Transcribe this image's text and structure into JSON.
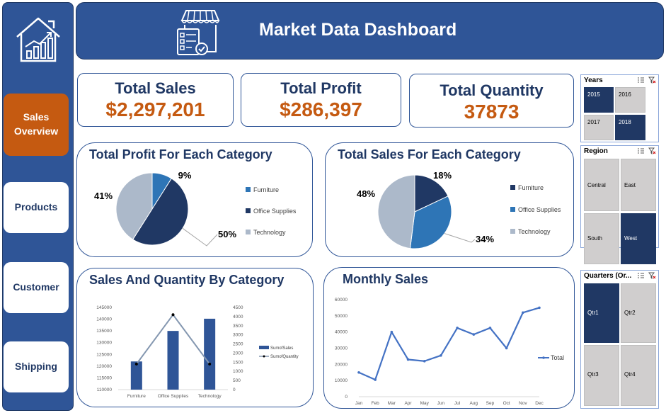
{
  "sidebar": {
    "logo_icon": "house-growth-chart-icon",
    "items": [
      {
        "label_lines": [
          "Sales",
          "Overview"
        ],
        "active": true
      },
      {
        "label_lines": [
          "Products"
        ],
        "active": false
      },
      {
        "label_lines": [
          "Customer"
        ],
        "active": false
      },
      {
        "label_lines": [
          "Shipping"
        ],
        "active": false
      }
    ]
  },
  "header": {
    "logo_icon": "storefront-checklist-icon",
    "title": "Market Data Dashboard"
  },
  "kpis": [
    {
      "label": "Total Sales",
      "value": "$2,297,201"
    },
    {
      "label": "Total Profit",
      "value": "$286,397"
    },
    {
      "label": "Total Quantity",
      "value": "37873"
    }
  ],
  "colors": {
    "navy": "#203864",
    "blue": "#2f5597",
    "mid_blue": "#2e75b6",
    "light_gray_blue": "#acb9ca",
    "accent_orange": "#c55a11",
    "tile_gray": "#d0cece"
  },
  "slicers": {
    "years": {
      "title": "Years",
      "items": [
        {
          "label": "2015",
          "selected": true
        },
        {
          "label": "2016",
          "selected": false
        },
        {
          "label": "2017",
          "selected": false
        },
        {
          "label": "2018",
          "selected": true
        }
      ]
    },
    "region": {
      "title": "Region",
      "items": [
        {
          "label": "Central",
          "selected": false
        },
        {
          "label": "East",
          "selected": false
        },
        {
          "label": "South",
          "selected": false
        },
        {
          "label": "West",
          "selected": true
        }
      ]
    },
    "quarters": {
      "title": "Quarters (Or...",
      "items": [
        {
          "label": "Qtr1",
          "selected": true
        },
        {
          "label": "Qtr2",
          "selected": false
        },
        {
          "label": "Qtr3",
          "selected": false
        },
        {
          "label": "Qtr4",
          "selected": false
        }
      ]
    }
  },
  "chart_data": [
    {
      "type": "pie",
      "title": "Total Profit For Each Category",
      "categories": [
        "Furniture",
        "Office Supplies",
        "Technology"
      ],
      "values": [
        9,
        50,
        41
      ],
      "value_labels": [
        "9%",
        "50%",
        "41%"
      ],
      "colors": [
        "#2e75b6",
        "#203864",
        "#acb9ca"
      ],
      "legend": "right"
    },
    {
      "type": "pie",
      "title": "Total Sales For Each Category",
      "categories": [
        "Furniture",
        "Office Supplies",
        "Technology"
      ],
      "values": [
        18,
        34,
        48
      ],
      "value_labels": [
        "18%",
        "34%",
        "48%"
      ],
      "colors": [
        "#203864",
        "#2e75b6",
        "#acb9ca"
      ],
      "legend": "right"
    },
    {
      "type": "bar",
      "title": "Sales And Quantity By Category",
      "categories": [
        "Furniture",
        "Office Supplies",
        "Technology"
      ],
      "series": [
        {
          "name": "Sum of Sales",
          "type": "bar",
          "axis": "left",
          "values": [
            122000,
            135000,
            140200
          ]
        },
        {
          "name": "Sum of Quantity",
          "type": "line",
          "axis": "right",
          "values": [
            1400,
            4100,
            1400
          ]
        }
      ],
      "ylim": [
        110000,
        145000
      ],
      "yticks": [
        "145000",
        "140000",
        "135000",
        "130000",
        "125000",
        "120000",
        "115000",
        "110000"
      ],
      "y2lim": [
        0,
        4500
      ],
      "y2ticks": [
        "4500",
        "4000",
        "3500",
        "3000",
        "2500",
        "2000",
        "1500",
        "1000",
        "500",
        "0"
      ],
      "legend": "right"
    },
    {
      "type": "line",
      "title": "Monthly Sales",
      "categories": [
        "Jan",
        "Feb",
        "Mar",
        "Apr",
        "May",
        "Jun",
        "Jul",
        "Aug",
        "Sep",
        "Oct",
        "Nov",
        "Dec"
      ],
      "series": [
        {
          "name": "Total",
          "values": [
            15000,
            10500,
            40000,
            23000,
            22000,
            25500,
            42500,
            38500,
            42500,
            30000,
            52000,
            55000
          ]
        }
      ],
      "ylim": [
        0,
        60000
      ],
      "yticks": [
        "60000",
        "50000",
        "40000",
        "30000",
        "20000",
        "10000",
        "0"
      ],
      "legend": "right"
    }
  ]
}
